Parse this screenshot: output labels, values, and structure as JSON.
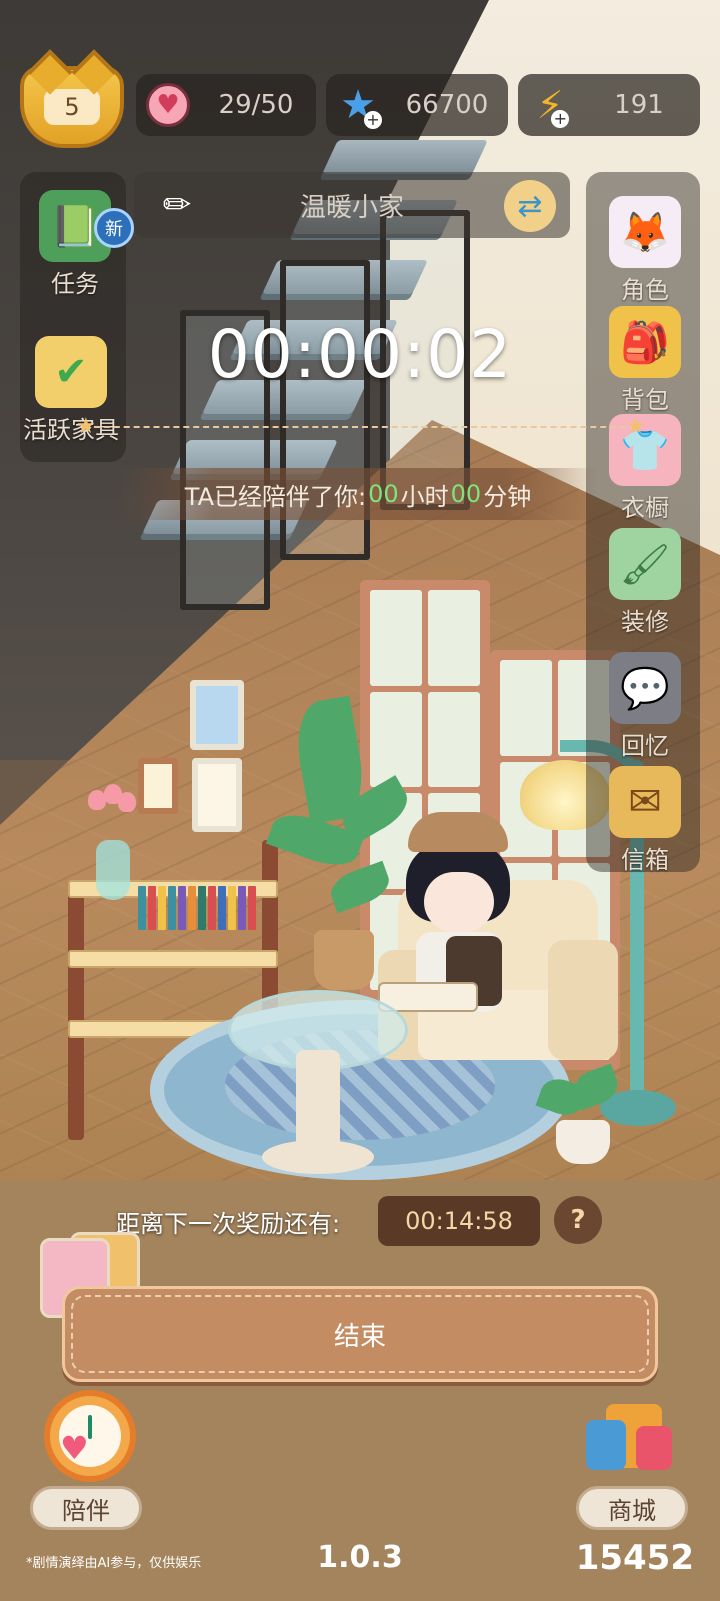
{
  "level": "5",
  "resources": {
    "hearts": "29/50",
    "stars": "66700",
    "energy": "191"
  },
  "room": {
    "name": "温暖小家"
  },
  "left_menu": {
    "task_label": "任务",
    "task_badge": "新",
    "furniture_label": "活跃家具"
  },
  "right_menu": {
    "items": [
      {
        "label": "角色",
        "icon": "fox-character-icon"
      },
      {
        "label": "背包",
        "icon": "backpack-icon"
      },
      {
        "label": "衣橱",
        "icon": "shirt-icon"
      },
      {
        "label": "装修",
        "icon": "paint-roller-icon"
      },
      {
        "label": "回忆",
        "icon": "chat-bubbles-icon"
      },
      {
        "label": "信箱",
        "icon": "envelope-icon"
      }
    ]
  },
  "timer": {
    "elapsed": "00:00:02"
  },
  "companion": {
    "prefix": "TA已经陪伴了你:",
    "hours": "00",
    "hours_unit": "小时",
    "minutes": "00",
    "minutes_unit": "分钟"
  },
  "reward": {
    "label": "距离下一次奖励还有:",
    "countdown": "00:14:58",
    "help": "?"
  },
  "end_button": {
    "label": "结束"
  },
  "bottom": {
    "accompany_label": "陪伴",
    "shop_label": "商城",
    "version": "1.0.3",
    "score": "15452",
    "disclaimer": "*剧情演绎由AI参与，仅供娱乐"
  },
  "colors": {
    "highlight_green": "#7fe27b",
    "button_brown": "#c48c63",
    "countdown_bg": "#5a3a26"
  }
}
